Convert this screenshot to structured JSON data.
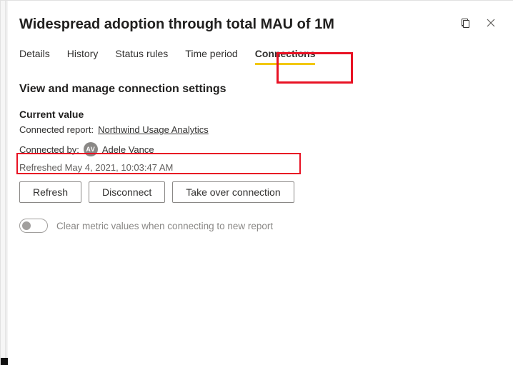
{
  "header": {
    "title": "Widespread adoption through total MAU of 1M"
  },
  "tabs": {
    "items": [
      {
        "label": "Details"
      },
      {
        "label": "History"
      },
      {
        "label": "Status rules"
      },
      {
        "label": "Time period"
      },
      {
        "label": "Connections"
      }
    ],
    "active_index": 4
  },
  "section": {
    "title": "View and manage connection settings",
    "current_value_label": "Current value",
    "connected_report_prefix": "Connected report:",
    "connected_report_name": "Northwind Usage Analytics",
    "connected_by_prefix": "Connected by:",
    "connected_by_initials": "AV",
    "connected_by_name": "Adele Vance",
    "refreshed_text": "Refreshed May 4, 2021, 10:03:47 AM"
  },
  "buttons": {
    "refresh": "Refresh",
    "disconnect": "Disconnect",
    "take_over": "Take over connection"
  },
  "toggle": {
    "state": "off",
    "label": "Clear metric values when connecting to new report"
  }
}
